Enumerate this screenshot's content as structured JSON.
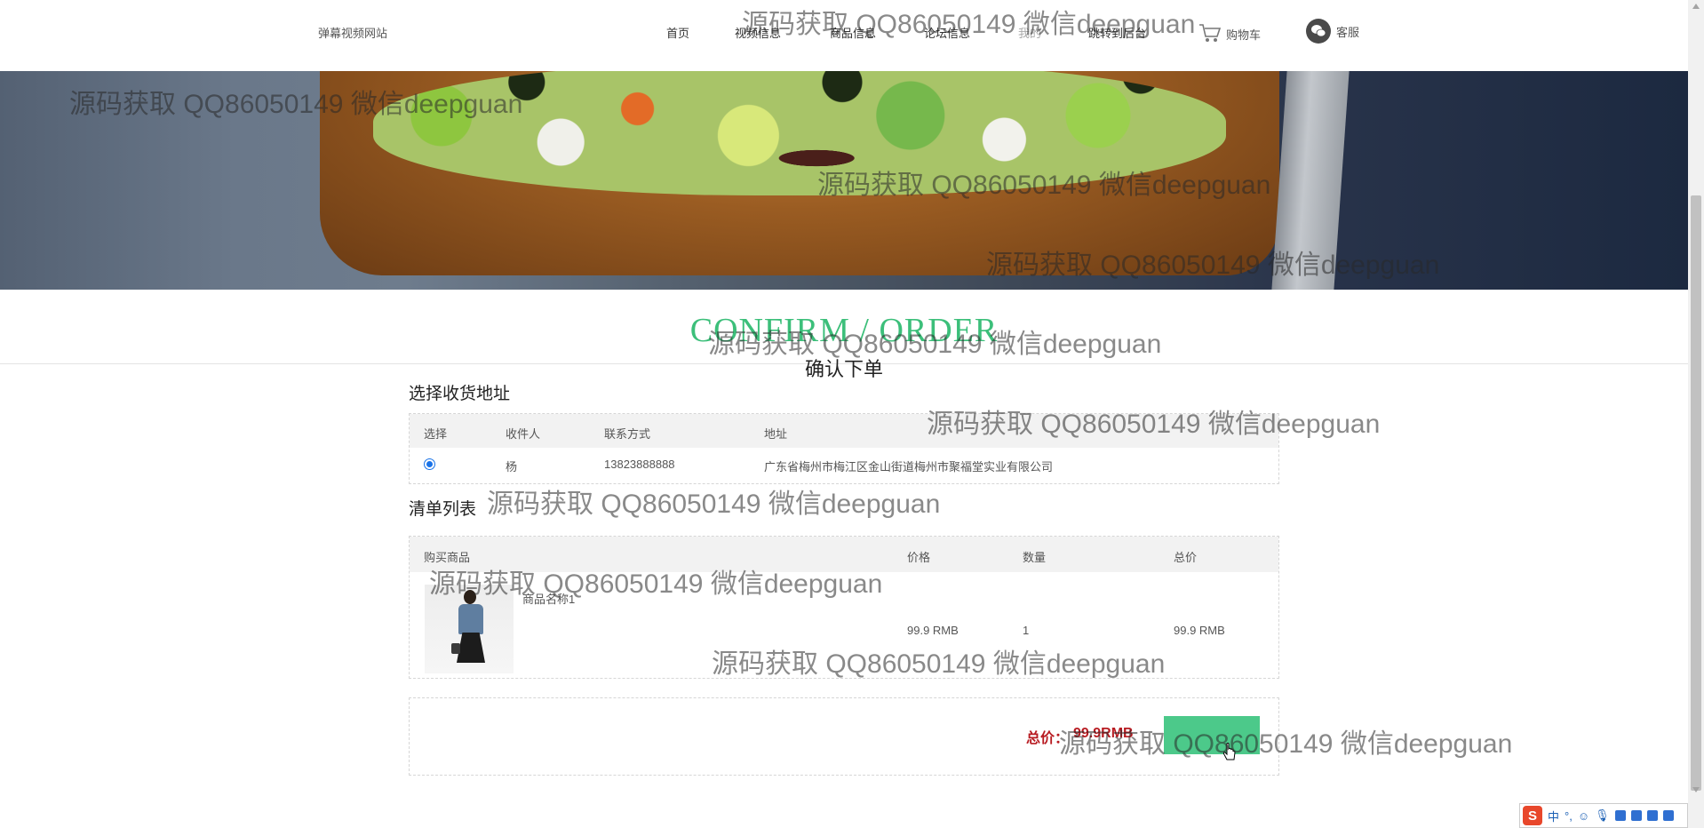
{
  "nav": {
    "site_title": "弹幕视频网站",
    "links": [
      "首页",
      "视频信息",
      "商品信息",
      "论坛信息",
      "我的",
      "跳转到后台"
    ],
    "cart_label": "购物车",
    "service_label": "客服"
  },
  "heading": {
    "english": "CONFIRM / ORDER",
    "chinese": "确认下单"
  },
  "address_section": {
    "title": "选择收货地址",
    "columns": [
      "选择",
      "收件人",
      "联系方式",
      "地址"
    ],
    "rows": [
      {
        "selected": true,
        "recipient": "杨",
        "phone": "13823888888",
        "address": "广东省梅州市梅江区金山街道梅州市聚福堂实业有限公司"
      }
    ]
  },
  "list_section": {
    "title": "清单列表",
    "columns": [
      "购买商品",
      "价格",
      "数量",
      "总价"
    ],
    "items": [
      {
        "name": "商品名称1",
        "price": "99.9 RMB",
        "quantity": "1",
        "total": "99.9 RMB"
      }
    ]
  },
  "summary": {
    "total_label": "总价：",
    "total_value": "99.9RMB",
    "submit_label": ""
  },
  "watermark_text": "源码获取 QQ86050149 微信deepguan",
  "ime": {
    "lang": "中",
    "punct": "°,"
  },
  "colors": {
    "accent_green": "#3cbf7a",
    "button_green": "#4cc98a",
    "price_red": "#b81c22",
    "radio_blue": "#1a73e8"
  }
}
